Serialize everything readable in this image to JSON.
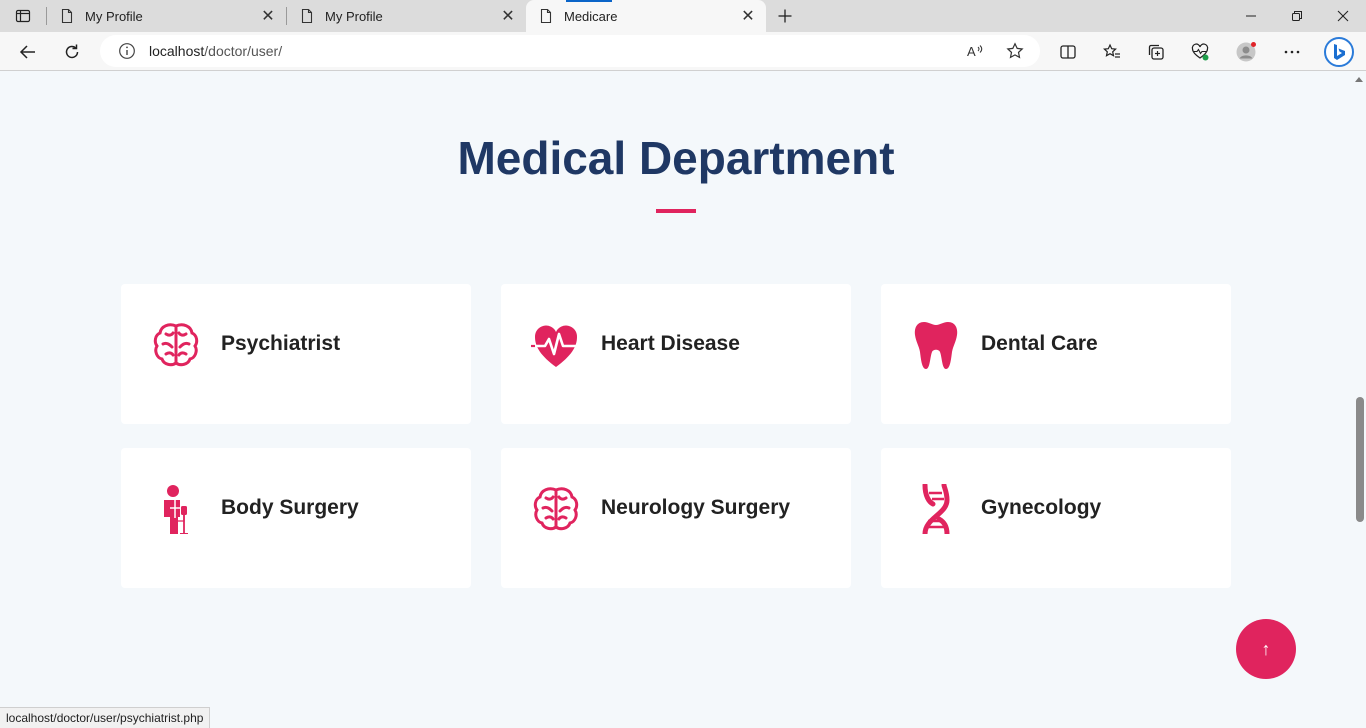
{
  "browser": {
    "tabs": [
      {
        "title": "My Profile",
        "active": false
      },
      {
        "title": "My Profile",
        "active": false
      },
      {
        "title": "Medicare",
        "active": true
      }
    ],
    "url_host": "localhost",
    "url_path": "/doctor/user/"
  },
  "section": {
    "title": "Medical Department",
    "accent_color": "#e0245e",
    "title_color": "#1f3864"
  },
  "departments": [
    {
      "label": "Psychiatrist",
      "icon": "brain-icon"
    },
    {
      "label": "Heart Disease",
      "icon": "heart-pulse-icon"
    },
    {
      "label": "Dental Care",
      "icon": "tooth-icon"
    },
    {
      "label": "Body Surgery",
      "icon": "patient-drip-icon"
    },
    {
      "label": "Neurology Surgery",
      "icon": "brain-icon"
    },
    {
      "label": "Gynecology",
      "icon": "dna-icon"
    }
  ],
  "back_to_top": {
    "label": "↑"
  },
  "status_bar": {
    "text": "localhost/doctor/user/psychiatrist.php"
  }
}
